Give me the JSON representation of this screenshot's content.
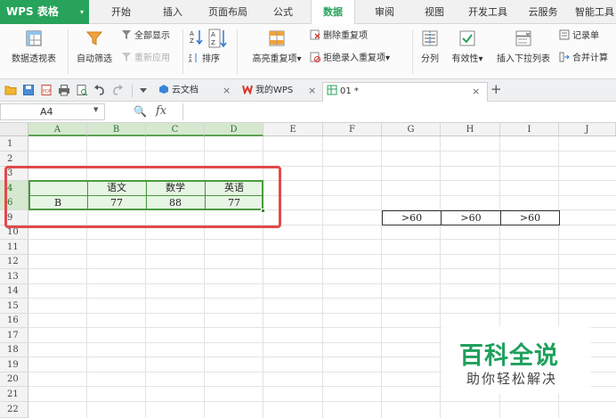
{
  "app": {
    "name": "WPS 表格",
    "arrow": "▾"
  },
  "menu": [
    "开始",
    "插入",
    "页面布局",
    "公式",
    "数据",
    "审阅",
    "视图",
    "开发工具",
    "云服务",
    "智能工具"
  ],
  "active_menu": "数据",
  "ribbon": {
    "pivot": "数据透视表",
    "auto_filter": "自动筛选",
    "show_all": "全部显示",
    "reapply": "重新应用",
    "sort": "排序",
    "highlight_dup": "高亮重复项",
    "remove_dup": "删除重复项",
    "reject_dup": "拒绝录入重复项",
    "split": "分列",
    "validity": "有效性",
    "dropdown": "插入下拉列表",
    "record": "记录单",
    "consolidate": "合并计算",
    "dropdown_arrow": "▾"
  },
  "tabs": [
    {
      "label": "云文档",
      "icon": "cloud-icon"
    },
    {
      "label": "我的WPS",
      "icon": "wps-icon"
    },
    {
      "label": "01 *",
      "icon": "sheet-icon",
      "active": true
    }
  ],
  "tab_close": "×",
  "tab_plus": "+",
  "formula_bar": {
    "cell_ref": "A4",
    "fx": "fx",
    "value": ""
  },
  "columns": [
    "A",
    "B",
    "C",
    "D",
    "E",
    "F",
    "G",
    "H",
    "I",
    "J"
  ],
  "selected_columns": [
    "A",
    "B",
    "C",
    "D"
  ],
  "rows": [
    "1",
    "2",
    "3",
    "4",
    "6",
    "9",
    "10",
    "11",
    "12",
    "13",
    "14",
    "15",
    "16",
    "17",
    "18",
    "19",
    "20",
    "21",
    "22"
  ],
  "selected_rows": [
    "4",
    "6"
  ],
  "cells": {
    "B4": "语文",
    "C4": "数学",
    "D4": "英语",
    "A6": "B",
    "B6": "77",
    "C6": "88",
    "D6": "77",
    "G9": ">60",
    "H9": ">60",
    "I9": ">60"
  },
  "colors": {
    "accent_green": "#27a35b",
    "selection_green": "#4a9a3e",
    "annotation_red": "#e24a4a"
  },
  "watermark": {
    "title": "百科全说",
    "subtitle": "助你轻松解决"
  }
}
